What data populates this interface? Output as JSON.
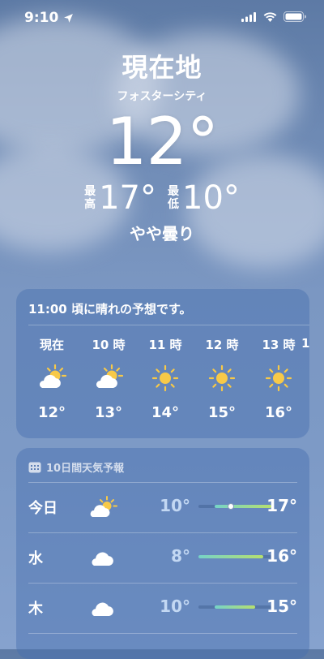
{
  "status": {
    "time": "9:10",
    "icons": [
      "location-arrow-icon",
      "signal-bars-icon",
      "wifi-icon",
      "battery-icon"
    ]
  },
  "hero": {
    "location": "現在地",
    "sublocation": "フォスターシティ",
    "temperature": "12°",
    "high_label_line1": "最",
    "high_label_line2": "高",
    "high_value": "17°",
    "low_label_line1": "最",
    "low_label_line2": "低",
    "low_value": "10°",
    "condition": "やや曇り"
  },
  "hourly": {
    "description": "11:00 頃に晴れの予想です。",
    "items": [
      {
        "label": "現在",
        "icon": "partly-cloudy-icon",
        "temp": "12°"
      },
      {
        "label": "10 時",
        "icon": "partly-cloudy-icon",
        "temp": "13°"
      },
      {
        "label": "11 時",
        "icon": "sun-icon",
        "temp": "14°"
      },
      {
        "label": "12 時",
        "icon": "sun-icon",
        "temp": "15°"
      },
      {
        "label": "13 時",
        "icon": "sun-icon",
        "temp": "16°"
      },
      {
        "label": "1"
      }
    ]
  },
  "daily": {
    "header": "10日間天気予報",
    "header_icon": "calendar-icon",
    "range_min": 8,
    "range_max": 17,
    "rows": [
      {
        "day": "今日",
        "icon": "partly-cloudy-icon",
        "low": "10°",
        "high": "17°",
        "low_val": 10,
        "high_val": 17,
        "current_val": 12
      },
      {
        "day": "水",
        "icon": "cloud-icon",
        "low": "8°",
        "high": "16°",
        "low_val": 8,
        "high_val": 16
      },
      {
        "day": "木",
        "icon": "cloud-icon",
        "low": "10°",
        "high": "15°",
        "low_val": 10,
        "high_val": 15
      }
    ]
  },
  "colors": {
    "sky": "#6f8bb5",
    "card": "#466eaf",
    "sun": "#f7c948",
    "bar_start": "#76d3c8",
    "bar_end": "#b6e06e"
  }
}
